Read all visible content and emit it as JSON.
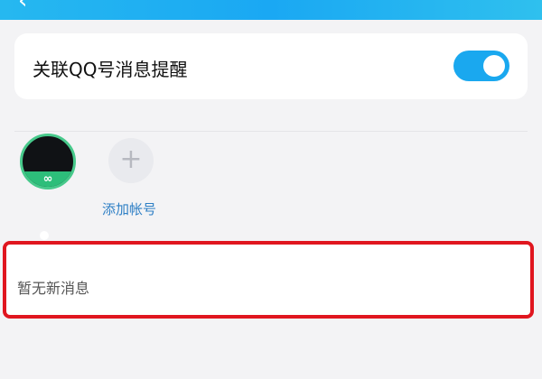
{
  "header": {
    "title": ""
  },
  "toggle": {
    "label": "关联QQ号消息提醒",
    "state": "on",
    "accent": "#1aa8ef"
  },
  "accounts": {
    "badge_icon": "link-icon",
    "add": {
      "icon": "plus-icon",
      "label": "添加帐号"
    }
  },
  "messages": {
    "empty_text": "暂无新消息",
    "highlight_color": "#e0161f"
  }
}
